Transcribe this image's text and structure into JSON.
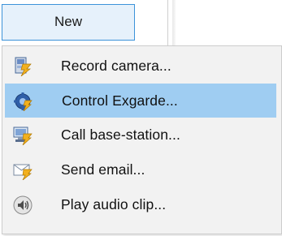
{
  "toolbar": {
    "new_label": "New"
  },
  "menu": {
    "items": [
      {
        "label": "Record camera...",
        "icon": "record-camera-icon",
        "highlighted": false
      },
      {
        "label": "Control Exgarde...",
        "icon": "control-exgarde-icon",
        "highlighted": true
      },
      {
        "label": "Call base-station...",
        "icon": "call-base-station-icon",
        "highlighted": false
      },
      {
        "label": "Send email...",
        "icon": "send-email-icon",
        "highlighted": false
      },
      {
        "label": "Play audio clip...",
        "icon": "play-audio-clip-icon",
        "highlighted": false
      }
    ]
  },
  "colors": {
    "highlight": "#9fcdf2",
    "button_border": "#3c93d9",
    "menu_background": "#f2f2f2"
  }
}
